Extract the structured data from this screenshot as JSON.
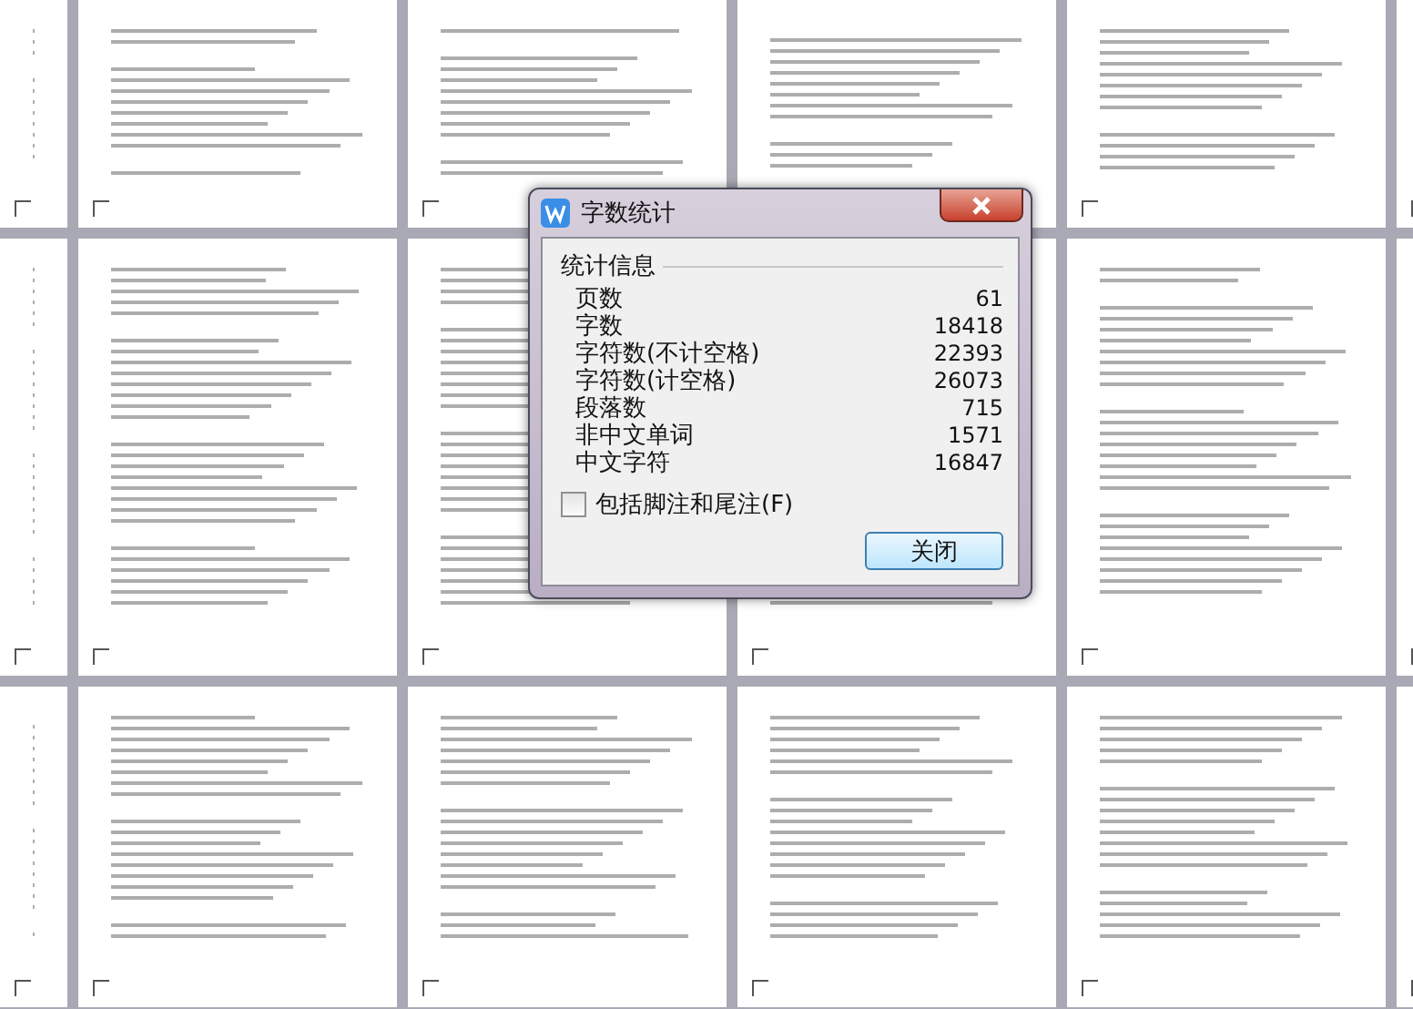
{
  "dialog": {
    "title": "字数统计",
    "group_label": "统计信息",
    "stats": [
      {
        "label": "页数",
        "value": "61"
      },
      {
        "label": "字数",
        "value": "18418"
      },
      {
        "label": "字符数(不计空格)",
        "value": "22393"
      },
      {
        "label": "字符数(计空格)",
        "value": "26073"
      },
      {
        "label": "段落数",
        "value": "715"
      },
      {
        "label": "非中文单词",
        "value": "1571"
      },
      {
        "label": "中文字符",
        "value": "16847"
      }
    ],
    "checkbox": {
      "label": "包括脚注和尾注(F)",
      "checked": false
    },
    "buttons": [
      {
        "label": "关闭",
        "default": true
      }
    ]
  }
}
